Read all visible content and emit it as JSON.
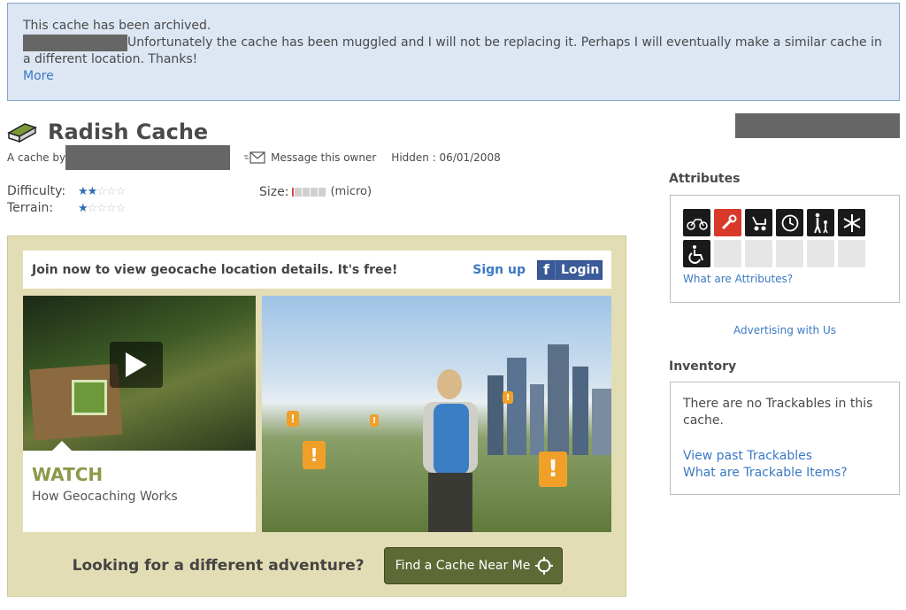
{
  "banner": {
    "line1": "This cache has been archived.",
    "line2": "Unfortunately the cache has been muggled and I will not be replacing it. Perhaps I will eventually make a similar cache in a different location. Thanks!",
    "more": "More"
  },
  "cache": {
    "title": "Radish Cache",
    "by_label": "A cache by",
    "message_owner": "Message this owner",
    "hidden": "Hidden : 06/01/2008",
    "difficulty_label": "Difficulty:",
    "terrain_label": "Terrain:",
    "difficulty": 2,
    "terrain": 1,
    "size_label": "Size:",
    "size_value": "(micro)"
  },
  "promo": {
    "join_text": "Join now to view geocache location details. It's free!",
    "signup": "Sign up",
    "login": "Login",
    "facebook_letter": "f",
    "watch": "WATCH",
    "how": "How Geocaching Works",
    "different": "Looking for a different adventure?",
    "find_button": "Find a Cache Near Me"
  },
  "sidebar": {
    "attributes_title": "Attributes",
    "what_attributes": "What are Attributes?",
    "advertising": "Advertising with Us",
    "inventory_title": "Inventory",
    "inventory_text": "There are no Trackables in this cache.",
    "view_past": "View past Trackables",
    "what_trackables": "What are Trackable Items?"
  },
  "colors": {
    "banner_bg": "#dde6f3",
    "link": "#3b79c3",
    "promo_bg": "#e3ddb5",
    "button_green": "#5e6a35"
  }
}
